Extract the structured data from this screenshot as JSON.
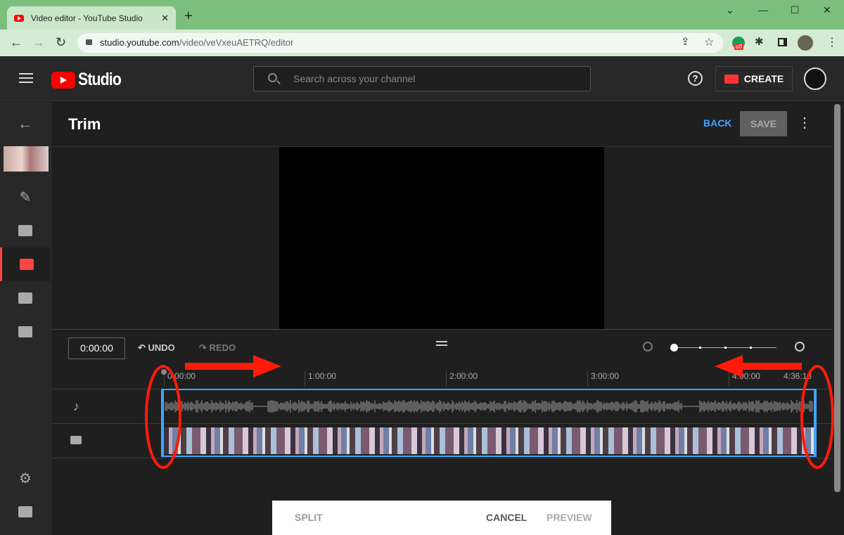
{
  "browser": {
    "tab_title": "Video editor - YouTube Studio",
    "url_host": "studio.youtube.com",
    "url_path": "/video/veVxeuAETRQ/editor",
    "extension_badge": "off"
  },
  "header": {
    "logo_text": "Studio",
    "search_placeholder": "Search across your channel",
    "help": "?",
    "create_label": "CREATE"
  },
  "sidebar": {
    "items": [
      "back-arrow",
      "details",
      "analytics",
      "editor",
      "comments",
      "subtitles",
      "settings",
      "feedback"
    ],
    "active": "editor"
  },
  "editor": {
    "title": "Trim",
    "back_label": "BACK",
    "save_label": "SAVE",
    "timecode": "0:00:00",
    "undo_label": "UNDO",
    "redo_label": "REDO"
  },
  "timeline": {
    "ticks": [
      "0:00:00",
      "1:00:00",
      "2:00:00",
      "3:00:00",
      "4:00:00",
      "4:36:13"
    ],
    "zoom_level": 0
  },
  "bottom": {
    "split_label": "SPLIT",
    "cancel_label": "CANCEL",
    "preview_label": "PREVIEW"
  },
  "colors": {
    "accent": "#3ea6ff",
    "brand": "#ff0000",
    "annotation": "#ff1a0a"
  }
}
